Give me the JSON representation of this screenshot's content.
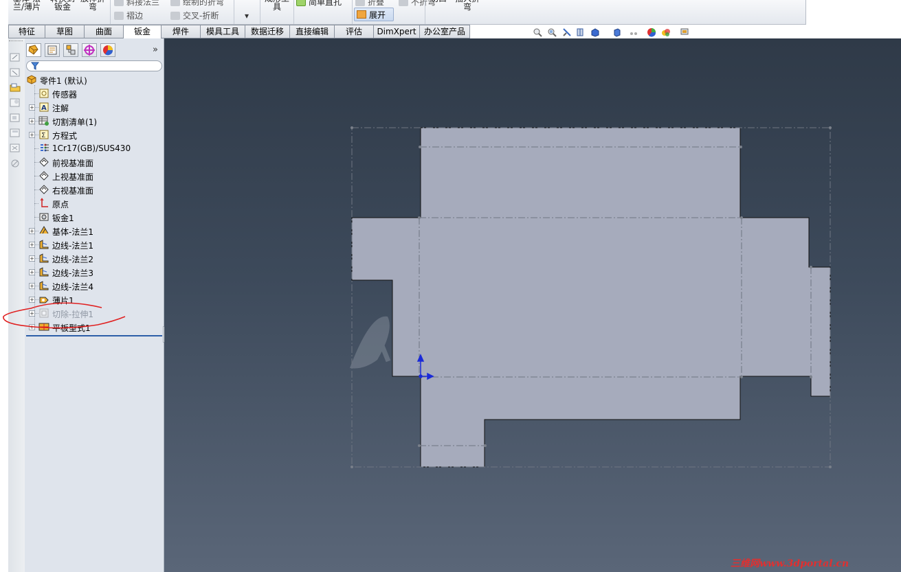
{
  "ribbon": {
    "big_buttons": [
      {
        "label": "基体-法\n兰/薄片"
      },
      {
        "label": "转换到\n钣金"
      },
      {
        "label": "放样折\n弯"
      },
      {
        "label": "成形工\n具"
      },
      {
        "label": "切口"
      },
      {
        "label": "插入折\n弯"
      }
    ],
    "small_buttons": [
      {
        "label": "斜接法兰"
      },
      {
        "label": "褶边"
      },
      {
        "label": "绘制的折弯"
      },
      {
        "label": "交叉-折断"
      },
      {
        "label": "简单直孔"
      },
      {
        "label": "折叠"
      },
      {
        "label": "不折弯"
      }
    ],
    "dropdown_arrow": "▾",
    "unfold_label": "展开"
  },
  "tabs": [
    {
      "label": "特征"
    },
    {
      "label": "草图"
    },
    {
      "label": "曲面"
    },
    {
      "label": "钣金",
      "active": true
    },
    {
      "label": "焊件"
    },
    {
      "label": "模具工具"
    },
    {
      "label": "数据迁移"
    },
    {
      "label": "直接编辑"
    },
    {
      "label": "评估"
    },
    {
      "label": "DimXpert"
    },
    {
      "label": "办公室产品"
    }
  ],
  "panel": {
    "collapse_glyph": "»",
    "tree": [
      {
        "label": "零件1  (默认)",
        "icon": "part-icon",
        "level": 0,
        "expander": false
      },
      {
        "label": "传感器",
        "icon": "sensor-icon",
        "level": 1,
        "expander": false
      },
      {
        "label": "注解",
        "icon": "annotation-icon",
        "level": 1,
        "expander": true
      },
      {
        "label": "切割清单(1)",
        "icon": "cut-list-icon",
        "level": 1,
        "expander": true
      },
      {
        "label": "方程式",
        "icon": "equation-icon",
        "level": 1,
        "expander": true
      },
      {
        "label": "1Cr17(GB)/SUS430",
        "icon": "material-icon",
        "level": 1,
        "expander": false
      },
      {
        "label": "前视基准面",
        "icon": "plane-icon",
        "level": 1,
        "expander": false
      },
      {
        "label": "上视基准面",
        "icon": "plane-icon",
        "level": 1,
        "expander": false
      },
      {
        "label": "右视基准面",
        "icon": "plane-icon",
        "level": 1,
        "expander": false
      },
      {
        "label": "原点",
        "icon": "origin-icon",
        "level": 1,
        "expander": false
      },
      {
        "label": "钣金1",
        "icon": "sheet-metal-icon",
        "level": 1,
        "expander": false
      },
      {
        "label": "基体-法兰1",
        "icon": "base-flange-icon",
        "level": 1,
        "expander": true
      },
      {
        "label": "边线-法兰1",
        "icon": "edge-flange-icon",
        "level": 1,
        "expander": true
      },
      {
        "label": "边线-法兰2",
        "icon": "edge-flange-icon",
        "level": 1,
        "expander": true
      },
      {
        "label": "边线-法兰3",
        "icon": "edge-flange-icon",
        "level": 1,
        "expander": true
      },
      {
        "label": "边线-法兰4",
        "icon": "edge-flange-icon",
        "level": 1,
        "expander": true
      },
      {
        "label": "薄片1",
        "icon": "tab-feature-icon",
        "level": 1,
        "expander": true
      },
      {
        "label": "切除-拉伸1",
        "icon": "cut-extrude-icon",
        "level": 1,
        "expander": true,
        "suppressed": true
      },
      {
        "label": "平板型式1",
        "icon": "flat-pattern-icon",
        "level": 1,
        "expander": true
      }
    ]
  },
  "viewport": {
    "background_top": "#2f3a48",
    "background_bottom": "#5a6678",
    "part_fill": "#a6abbc",
    "annotation_color": "#e02020"
  },
  "watermark": "三维网www.3dportal.cn"
}
